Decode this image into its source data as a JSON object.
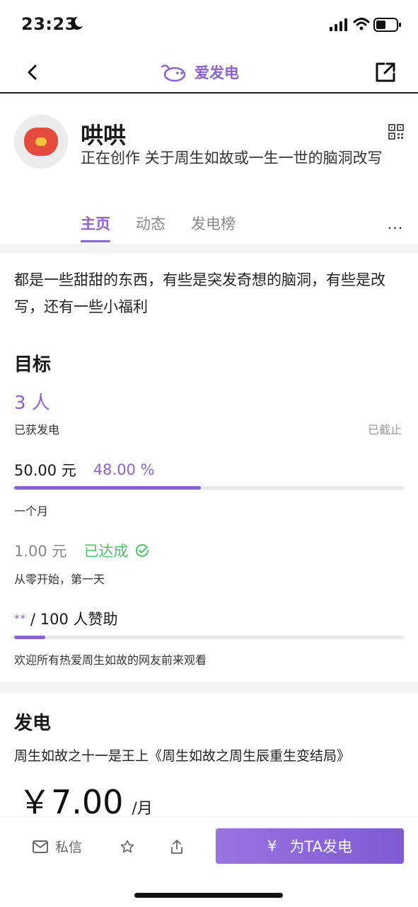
{
  "status_bar": {
    "time": "23:23"
  },
  "nav": {
    "brand_name": "爱发电"
  },
  "profile": {
    "name": "哄哄",
    "description": "正在创作 关于周生如故或一生一世的脑洞改写",
    "tabs": [
      {
        "label": "主页",
        "active": true
      },
      {
        "label": "动态",
        "active": false
      },
      {
        "label": "发电榜",
        "active": false
      }
    ],
    "more_label": "···"
  },
  "about": {
    "text": "都是一些甜甜的东西，有些是突发奇想的脑洞，有些是改写，还有一些小福利"
  },
  "goals": {
    "title": "目标",
    "supporters": "3 人",
    "supporters_label": "已获发电",
    "status": "已截止",
    "monthly_goal": {
      "amount": "50.00 元",
      "percent_text": "48.00 %",
      "progress": 0.48,
      "description": "一个月"
    },
    "first_goal": {
      "amount": "1.00 元",
      "status": "已达成",
      "description": "从零开始，第一天"
    },
    "sponsor_goal": {
      "current": "**",
      "target": "/ 100 人赞助",
      "progress": 0.08,
      "description": "欢迎所有热爱周生如故的网友前来观看"
    }
  },
  "power": {
    "title": "发电",
    "tier_name": "周生如故之十一是王上《周生如故之周生辰重生变结局》",
    "price": "￥7.00",
    "unit": "/月"
  },
  "bottom_bar": {
    "message_label": "私信",
    "cta_currency": "¥",
    "cta_label": "为TA发电"
  },
  "colors": {
    "accent": "#8a63d2",
    "success": "#4cc46a"
  }
}
